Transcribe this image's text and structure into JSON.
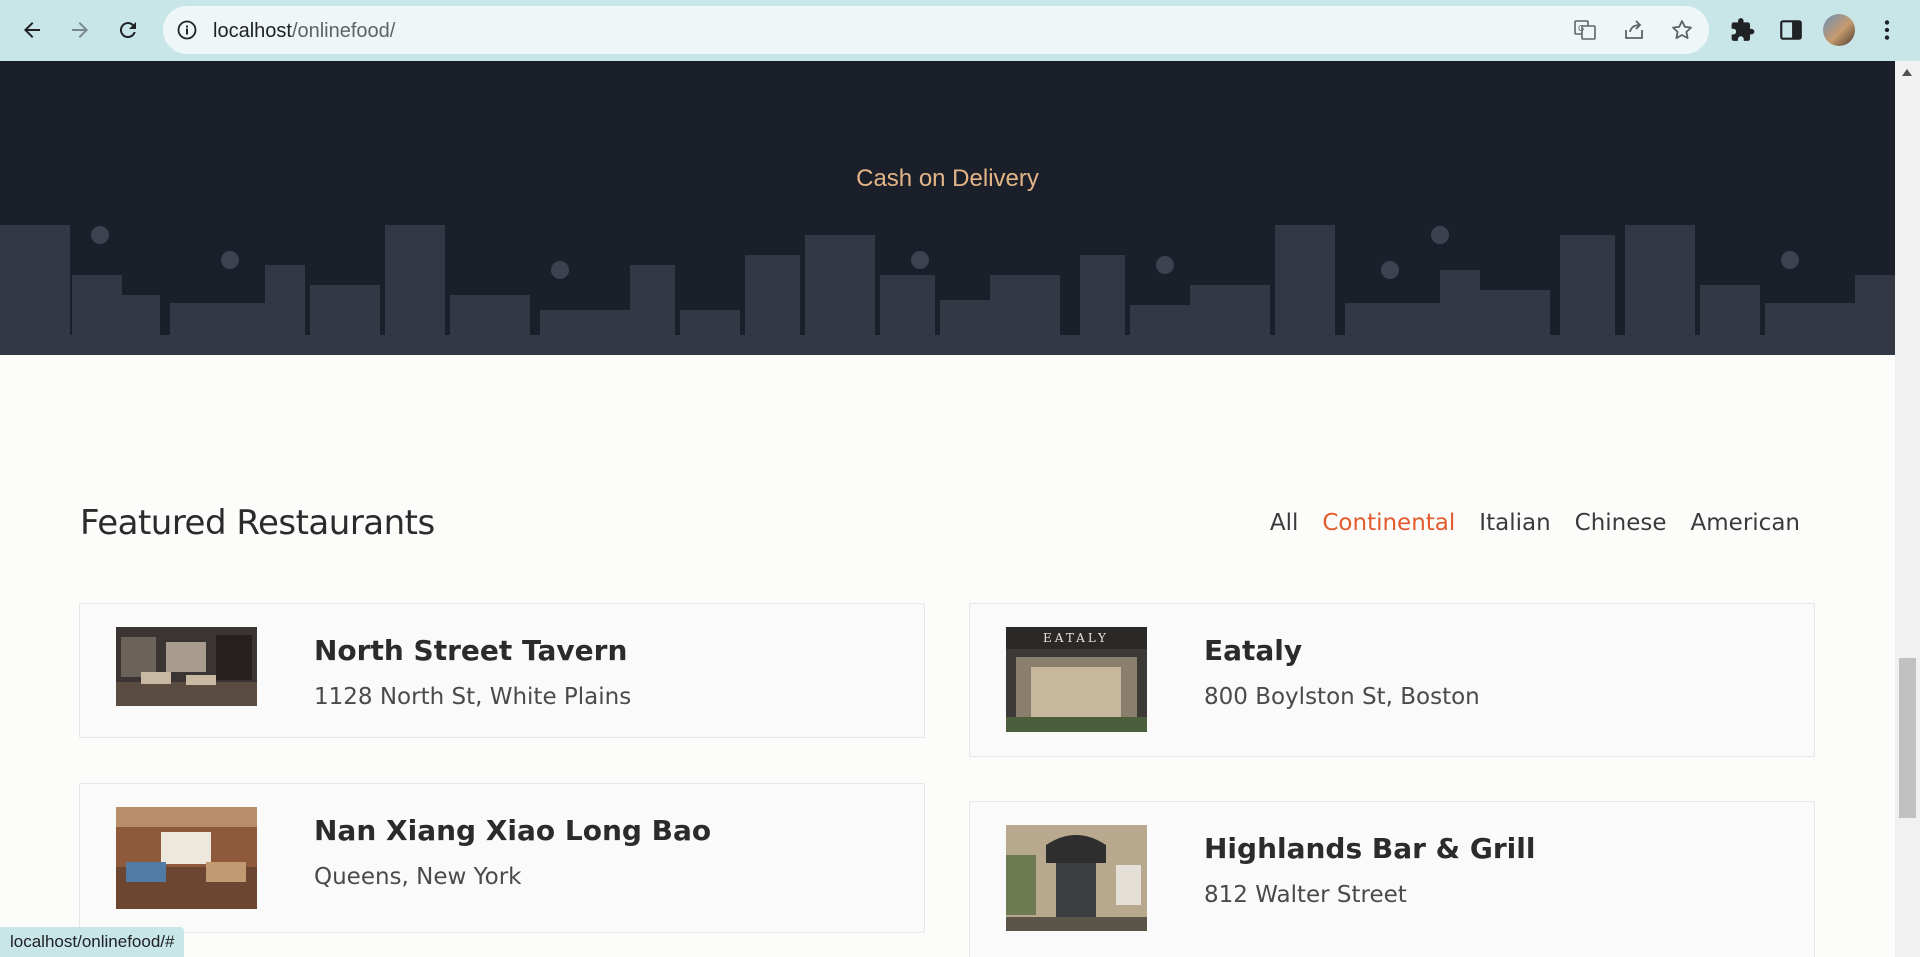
{
  "browser": {
    "url_host": "localhost",
    "url_path": "/onlinefood/",
    "status_url": "localhost/onlinefood/#"
  },
  "banner": {
    "text": "Cash on Delivery"
  },
  "featured": {
    "title": "Featured Restaurants",
    "filters": [
      {
        "label": "All",
        "active": false
      },
      {
        "label": "Continental",
        "active": true
      },
      {
        "label": "Italian",
        "active": false
      },
      {
        "label": "Chinese",
        "active": false
      },
      {
        "label": "American",
        "active": false
      }
    ],
    "restaurants": [
      {
        "name": "North Street Tavern",
        "address": "1128 North St, White Plains",
        "image": "restaurant-interior"
      },
      {
        "name": "Eataly",
        "address": "800 Boylston St, Boston",
        "image": "eataly-storefront",
        "sign": "EATALY"
      },
      {
        "name": "Nan Xiang Xiao Long Bao",
        "address": "Queens, New York",
        "image": "dining-room"
      },
      {
        "name": "Highlands Bar & Grill",
        "address": "812 Walter Street",
        "image": "storefront-awning"
      }
    ]
  },
  "colors": {
    "accent": "#e35b2c",
    "banner_bg": "#1b1f2a",
    "banner_text": "#e3b486",
    "chrome": "#c8e6e8"
  }
}
